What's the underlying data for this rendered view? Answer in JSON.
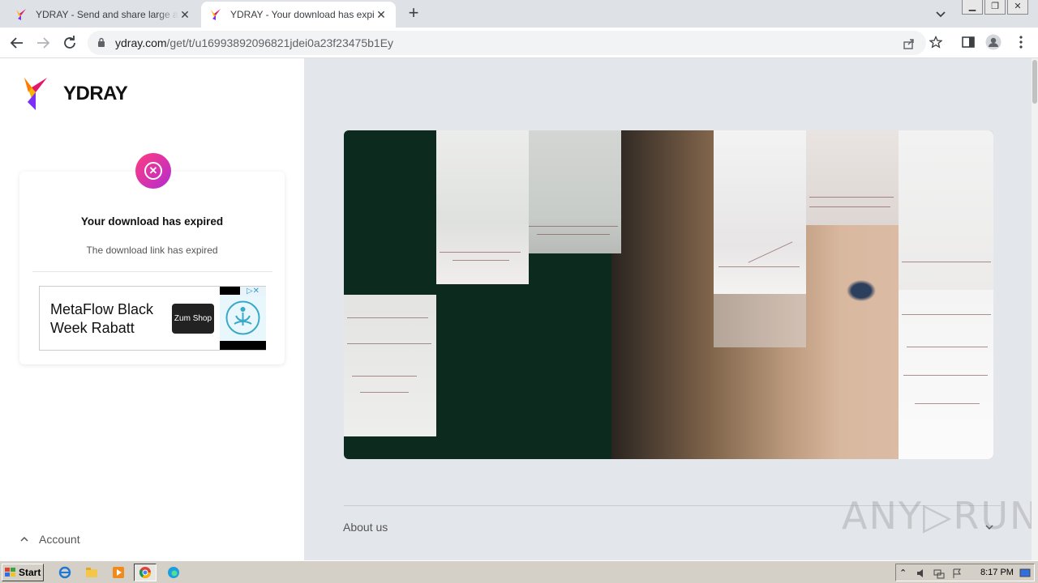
{
  "browser": {
    "tabs": [
      {
        "title": "YDRAY - Send and share large and big files",
        "active": false
      },
      {
        "title": "YDRAY - Your download has expired",
        "active": true
      }
    ],
    "url_host": "ydray.com",
    "url_path": "/get/t/u16993892096821jdei0a23f23475b1Ey",
    "new_tab_label": "+",
    "close_label": "✕"
  },
  "sidebar": {
    "brand": "YDRAY",
    "error_title": "Your download has expired",
    "error_subtitle": "The download link has expired",
    "account_label": "Account"
  },
  "ad": {
    "headline": "MetaFlow Black Week Rabatt",
    "cta": "Zum Shop",
    "adchoices": "▷✕"
  },
  "main": {
    "footer_link": "About us",
    "watermark": "ANY▷RUN"
  },
  "taskbar": {
    "start_label": "Start",
    "clock": "8:17 PM"
  },
  "colors": {
    "accent_gradient_start": "#ff3d7f",
    "accent_gradient_end": "#b42bd2",
    "page_background": "#e3e6ea",
    "hero_dark": "#0c2a1e"
  }
}
